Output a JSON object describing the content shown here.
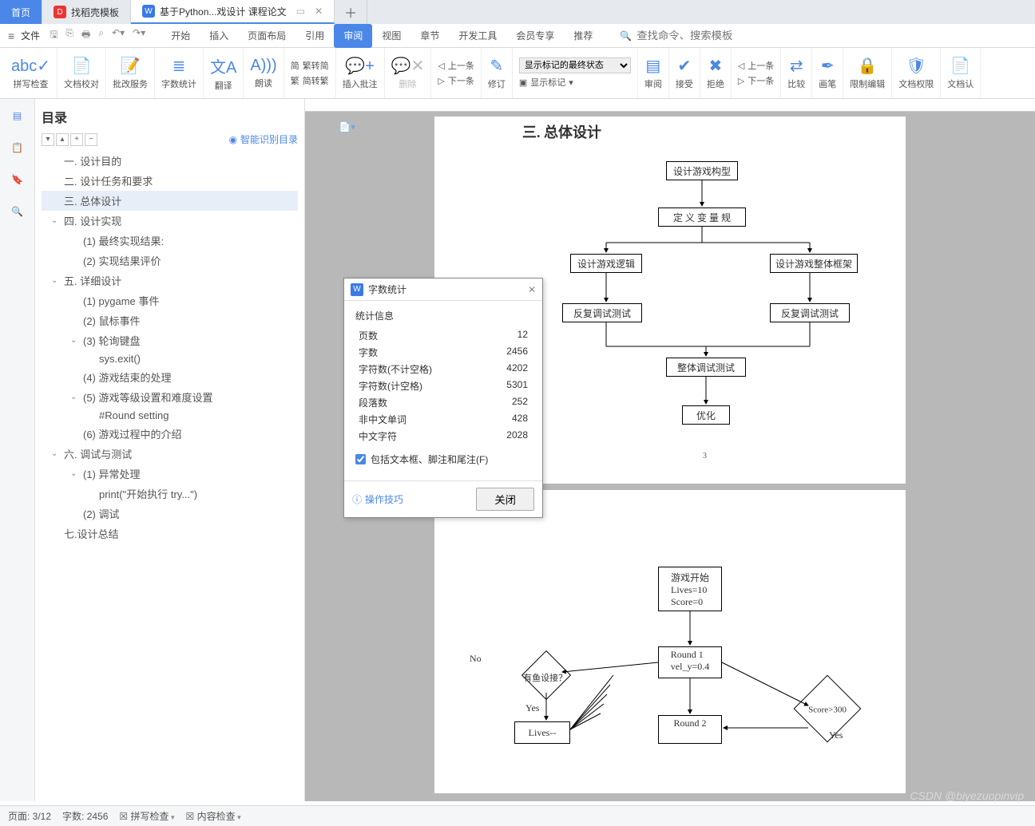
{
  "tabs": {
    "home": "首页",
    "templates": "找稻壳模板",
    "doc": "基于Python...戏设计 课程论文"
  },
  "menubar": {
    "file": "文件",
    "tabs": [
      "开始",
      "插入",
      "页面布局",
      "引用",
      "审阅",
      "视图",
      "章节",
      "开发工具",
      "会员专享",
      "推荐"
    ],
    "active": "审阅",
    "search_ph": "查找命令、搜索模板"
  },
  "toolbar": {
    "spell": "拼写检查",
    "docproof": "文档校对",
    "editservice": "批改服务",
    "wordcount": "字数统计",
    "translate": "翻译",
    "read": "朗读",
    "simp_trad1": "繁转简",
    "simp_trad2": "简转繁",
    "insert_comment": "插入批注",
    "delete": "删除",
    "prev_comment": "上一条",
    "next_comment": "下一条",
    "revise": "修订",
    "markup_select": "显示标记的最终状态",
    "show_markup": "显示标记",
    "review": "审阅",
    "accept": "接受",
    "reject": "拒绝",
    "prev_rev": "上一条",
    "next_rev": "下一条",
    "compare": "比较",
    "pen": "画笔",
    "restrict": "限制编辑",
    "docperm": "文档权限",
    "docrec": "文档认"
  },
  "toc": {
    "title": "目录",
    "smart": "智能识别目录",
    "items": [
      {
        "t": "一. 设计目的",
        "l": 1
      },
      {
        "t": "二. 设计任务和要求",
        "l": 1
      },
      {
        "t": "三. 总体设计",
        "l": 1,
        "sel": true
      },
      {
        "t": "四. 设计实现",
        "l": 1,
        "c": true
      },
      {
        "t": "(1) 最终实现结果:",
        "l": 2
      },
      {
        "t": "(2) 实现结果评价",
        "l": 2
      },
      {
        "t": "五. 详细设计",
        "l": 1,
        "c": true
      },
      {
        "t": "(1) pygame 事件",
        "l": 2
      },
      {
        "t": "(2) 鼠标事件",
        "l": 2
      },
      {
        "t": "(3) 轮询键盘",
        "l": 2,
        "c": true
      },
      {
        "t": "sys.exit()",
        "l": 3
      },
      {
        "t": "(4) 游戏结束的处理",
        "l": 2
      },
      {
        "t": "(5) 游戏等级设置和难度设置",
        "l": 2,
        "c": true
      },
      {
        "t": "#Round setting",
        "l": 3
      },
      {
        "t": "(6) 游戏过程中的介绍",
        "l": 2
      },
      {
        "t": "六. 调试与测试",
        "l": 1,
        "c": true
      },
      {
        "t": "(1) 异常处理",
        "l": 2,
        "c": true
      },
      {
        "t": "print(\"开始执行 try...\")",
        "l": 3
      },
      {
        "t": "(2) 调试",
        "l": 2
      },
      {
        "t": "七.设计总结",
        "l": 1
      }
    ]
  },
  "doc": {
    "heading": "三. 总体设计",
    "page_no": "3",
    "flow": [
      "设计游戏构型",
      "定 义 变 量 规",
      "设计游戏逻辑",
      "设计游戏整体框架",
      "反复调试测试",
      "反复调试测试",
      "整体调试测试",
      "优化"
    ],
    "flow2": {
      "start": "游戏开始\nLives=10\nScore=0",
      "r1": "Round 1\nvel_y=0.4",
      "r2": "Round 2",
      "score": "Score>300",
      "no": "No",
      "yes1": "Yes",
      "yes2": "Yes",
      "dec": "有鱼设接？",
      "lives": "Lives--"
    }
  },
  "popup": {
    "title": "字数统计",
    "section": "统计信息",
    "rows": [
      [
        "页数",
        "12"
      ],
      [
        "字数",
        "2456"
      ],
      [
        "字符数(不计空格)",
        "4202"
      ],
      [
        "字符数(计空格)",
        "5301"
      ],
      [
        "段落数",
        "252"
      ],
      [
        "非中文单词",
        "428"
      ],
      [
        "中文字符",
        "2028"
      ]
    ],
    "chk": "包括文本框、脚注和尾注(F)",
    "tip": "操作技巧",
    "close": "关闭"
  },
  "status": {
    "page": "页面: 3/12",
    "words": "字数: 2456",
    "spell": "拼写检查",
    "content": "内容检查"
  },
  "watermark": "CSDN @biyezuopinvip"
}
